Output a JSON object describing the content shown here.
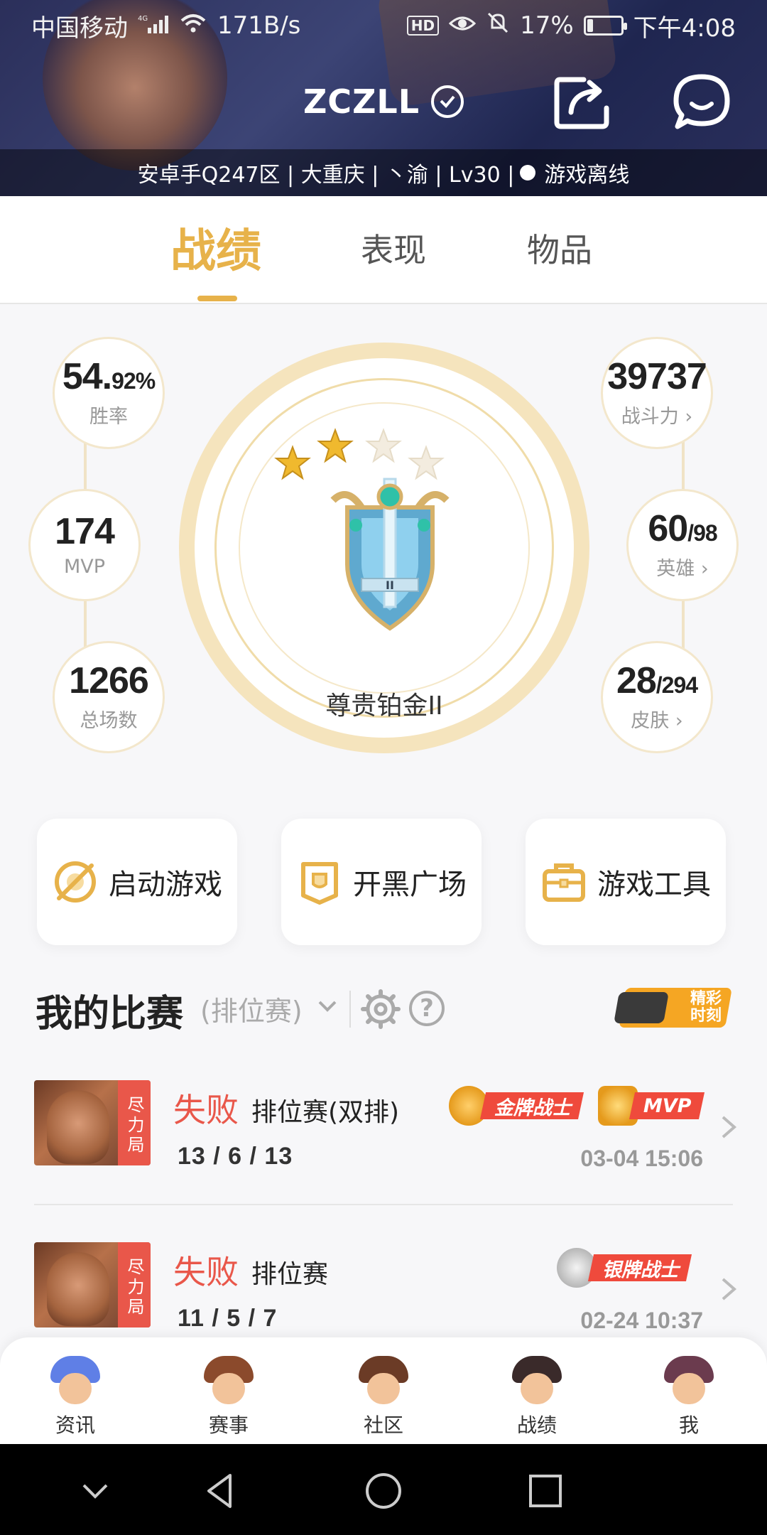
{
  "status_bar": {
    "carrier": "中国移动",
    "network": "4G",
    "speed": "171B/s",
    "battery": "17%",
    "time": "下午4:08"
  },
  "header": {
    "username": "ZCZLL",
    "subinfo": "安卓手Q247区 | 大重庆 | 丶渝 | Lv30 |",
    "status": "游戏离线"
  },
  "tabs": [
    "战绩",
    "表现",
    "物品"
  ],
  "stats": {
    "win_rate": {
      "main": "54.",
      "sub": "92%",
      "label": "胜率"
    },
    "mvp": {
      "value": "174",
      "label": "MVP"
    },
    "total": {
      "value": "1266",
      "label": "总场数"
    },
    "power": {
      "value": "39737",
      "label": "战斗力"
    },
    "heroes": {
      "main": "60",
      "sub": "/98",
      "label": "英雄"
    },
    "skins": {
      "main": "28",
      "sub": "/294",
      "label": "皮肤"
    }
  },
  "rank": {
    "name": "尊贵铂金II",
    "stars_filled": 2,
    "stars_total": 4
  },
  "actions": [
    {
      "label": "启动游戏",
      "icon": "launch-icon"
    },
    {
      "label": "开黑广场",
      "icon": "shield-icon"
    },
    {
      "label": "游戏工具",
      "icon": "toolbox-icon"
    }
  ],
  "matches_section": {
    "title": "我的比赛",
    "filter": "(排位赛)",
    "highlight_line1": "精彩",
    "highlight_line2": "时刻"
  },
  "matches": [
    {
      "tag": "尽力局",
      "result": "失败",
      "type": "排位赛(双排)",
      "kda": "13 / 6 / 13",
      "date": "03-04 15:06",
      "badge1": "金牌战士",
      "badge2": "MVP"
    },
    {
      "tag": "尽力局",
      "result": "失败",
      "type": "排位赛",
      "kda": "11 / 5 / 7",
      "date": "02-24 10:37",
      "badge1": "银牌战士"
    }
  ],
  "bottom_nav": [
    "资讯",
    "赛事",
    "社区",
    "战绩",
    "我"
  ],
  "colors": {
    "accent": "#e7b24a",
    "loss": "#e9574a"
  }
}
